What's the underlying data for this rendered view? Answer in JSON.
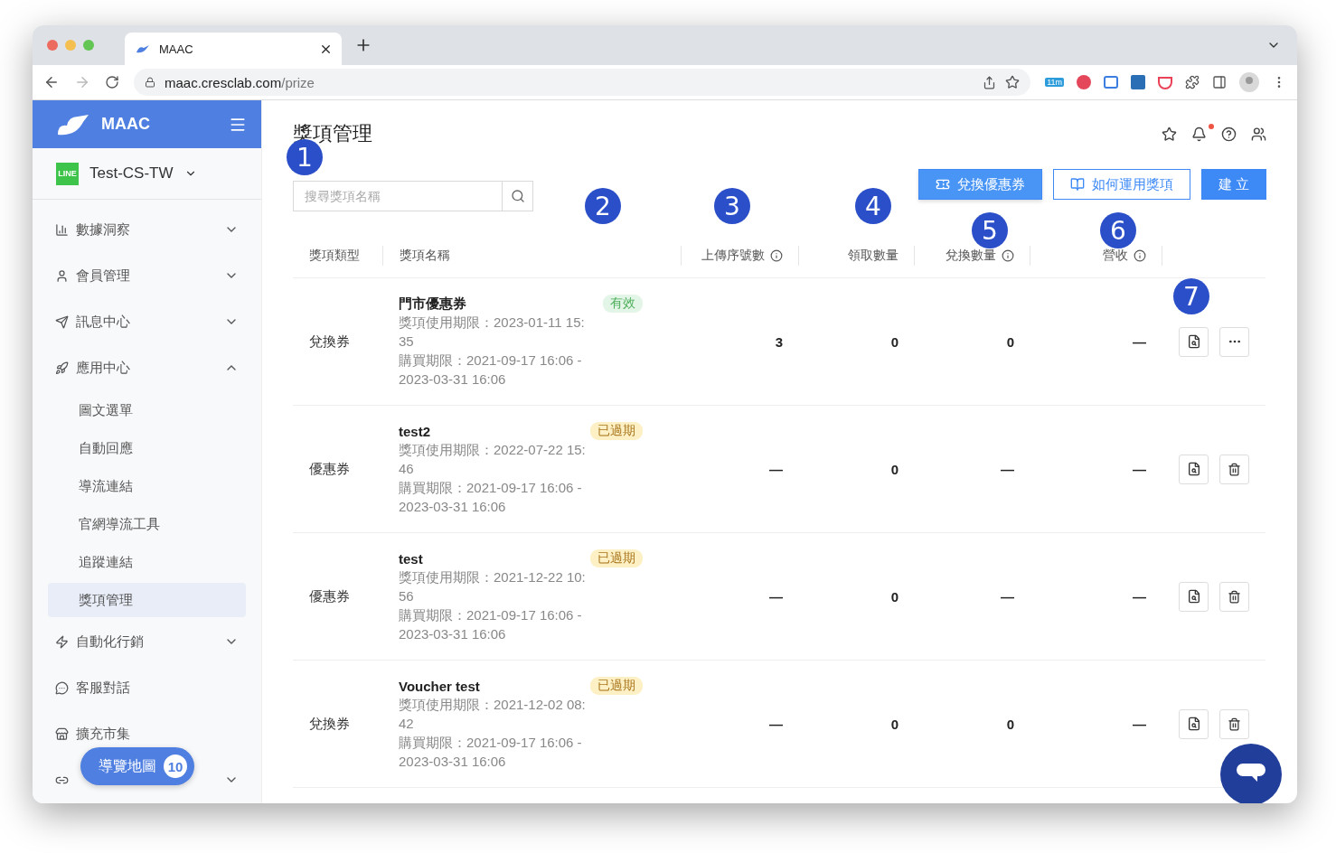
{
  "browser": {
    "tab_title": "MAAC",
    "url_host": "maac.cresclab.com",
    "url_path": "/prize",
    "extension_badge": "11m"
  },
  "sidebar": {
    "brand": "MAAC",
    "account_badge": "LINE",
    "account": "Test-CS-TW",
    "items": [
      {
        "kind": "group",
        "label": "數據洞察",
        "expanded": false
      },
      {
        "kind": "group",
        "label": "會員管理",
        "expanded": false
      },
      {
        "kind": "group",
        "label": "訊息中心",
        "expanded": false
      },
      {
        "kind": "group",
        "label": "應用中心",
        "expanded": true,
        "children": [
          {
            "label": "圖文選單",
            "selected": false
          },
          {
            "label": "自動回應",
            "selected": false
          },
          {
            "label": "導流連結",
            "selected": false
          },
          {
            "label": "官網導流工具",
            "selected": false
          },
          {
            "label": "追蹤連結",
            "selected": false
          },
          {
            "label": "獎項管理",
            "selected": true
          }
        ]
      },
      {
        "kind": "group",
        "label": "自動化行銷",
        "expanded": false
      },
      {
        "kind": "link",
        "label": "客服對話"
      },
      {
        "kind": "link",
        "label": "擴充市集"
      },
      {
        "kind": "group",
        "expanded": false
      }
    ],
    "tour_button": {
      "label": "導覽地圖",
      "count": "10"
    }
  },
  "page": {
    "title": "獎項管理",
    "search": {
      "placeholder": "搜尋獎項名稱"
    },
    "buttons": [
      {
        "kind": "primary",
        "label": "兌換優惠券"
      },
      {
        "kind": "outline",
        "label": "如何運用獎項"
      },
      {
        "kind": "solid",
        "label": "建 立"
      }
    ]
  },
  "table": {
    "columns": [
      {
        "label": "獎項類型",
        "info": false
      },
      {
        "label": "獎項名稱",
        "info": false
      },
      {
        "label": "上傳序號數",
        "info": true
      },
      {
        "label": "領取數量",
        "info": false
      },
      {
        "label": "兌換數量",
        "info": true
      },
      {
        "label": "營收",
        "info": true
      }
    ],
    "rows": [
      {
        "kind": "more",
        "type": "兌換券",
        "name": "門市優惠券",
        "status": {
          "label": "有效",
          "kind": "valid"
        },
        "use_period": "獎項使用期限：2023-01-11 15:35",
        "buy_period": "購買期限：2021-09-17 16:06 - 2023-03-31 16:06",
        "uploaded": "3",
        "claimed": "0",
        "redeemed": "0",
        "revenue": "—"
      },
      {
        "kind": "delete",
        "type": "優惠券",
        "name": "test2",
        "status": {
          "label": "已過期",
          "kind": "expired"
        },
        "use_period": "獎項使用期限：2022-07-22 15:46",
        "buy_period": "購買期限：2021-09-17 16:06 - 2023-03-31 16:06",
        "uploaded": "—",
        "claimed": "0",
        "redeemed": "—",
        "revenue": "—"
      },
      {
        "kind": "delete",
        "type": "優惠券",
        "name": "test",
        "status": {
          "label": "已過期",
          "kind": "expired"
        },
        "use_period": "獎項使用期限：2021-12-22 10:56",
        "buy_period": "購買期限：2021-09-17 16:06 - 2023-03-31 16:06",
        "uploaded": "—",
        "claimed": "0",
        "redeemed": "—",
        "revenue": "—"
      },
      {
        "kind": "delete",
        "type": "兌換券",
        "name": "Voucher test",
        "status": {
          "label": "已過期",
          "kind": "expired"
        },
        "use_period": "獎項使用期限：2021-12-02 08:42",
        "buy_period": "購買期限：2021-09-17 16:06 - 2023-03-31 16:06",
        "uploaded": "—",
        "claimed": "0",
        "redeemed": "0",
        "revenue": "—"
      }
    ]
  },
  "annotations": [
    "1",
    "2",
    "3",
    "4",
    "5",
    "6",
    "7"
  ]
}
